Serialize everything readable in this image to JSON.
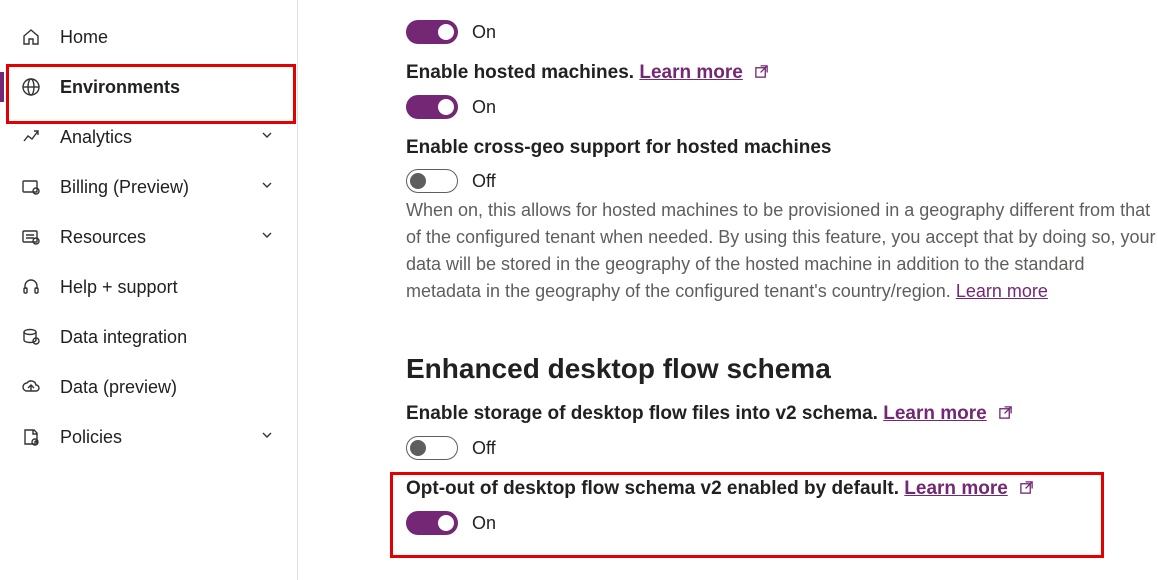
{
  "sidebar": {
    "items": [
      {
        "label": "Home",
        "expandable": false
      },
      {
        "label": "Environments",
        "expandable": false,
        "active": true
      },
      {
        "label": "Analytics",
        "expandable": true
      },
      {
        "label": "Billing (Preview)",
        "expandable": true
      },
      {
        "label": "Resources",
        "expandable": true
      },
      {
        "label": "Help + support",
        "expandable": false
      },
      {
        "label": "Data integration",
        "expandable": false
      },
      {
        "label": "Data (preview)",
        "expandable": false
      },
      {
        "label": "Policies",
        "expandable": true
      }
    ]
  },
  "settings": {
    "s0": {
      "state": "on",
      "state_label": "On"
    },
    "s1": {
      "title": "Enable hosted machines.",
      "learn": "Learn more",
      "state": "on",
      "state_label": "On"
    },
    "s2": {
      "title": "Enable cross-geo support for hosted machines",
      "state": "off",
      "state_label": "Off",
      "desc": "When on, this allows for hosted machines to be provisioned in a geography different from that of the configured tenant when needed. By using this feature, you accept that by doing so, your data will be stored in the geography of the hosted machine in addition to the standard metadata in the geography of the configured tenant's country/region.",
      "learn": "Learn more"
    },
    "section": "Enhanced desktop flow schema",
    "s3": {
      "title": "Enable storage of desktop flow files into v2 schema.",
      "learn": "Learn more",
      "state": "off",
      "state_label": "Off"
    },
    "s4": {
      "title": "Opt-out of desktop flow schema v2 enabled by default.",
      "learn": "Learn more",
      "state": "on",
      "state_label": "On"
    }
  }
}
